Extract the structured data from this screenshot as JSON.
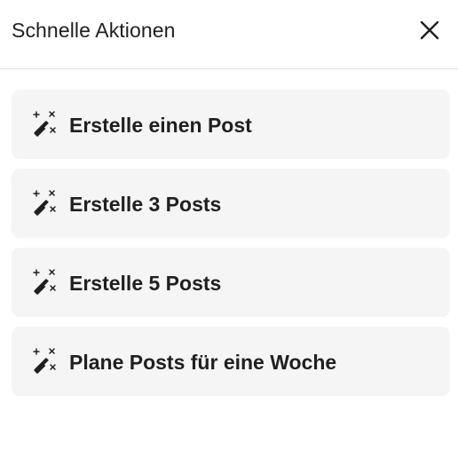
{
  "header": {
    "title": "Schnelle Aktionen",
    "close_icon": "close-icon"
  },
  "actions": [
    {
      "label": "Erstelle einen Post",
      "icon": "magic-wand-icon"
    },
    {
      "label": "Erstelle 3 Posts",
      "icon": "magic-wand-icon"
    },
    {
      "label": "Erstelle 5 Posts",
      "icon": "magic-wand-icon"
    },
    {
      "label": "Plane Posts für eine Woche",
      "icon": "magic-wand-icon"
    }
  ],
  "colors": {
    "background": "#ffffff",
    "card": "#f5f5f5",
    "text": "#1f1f1f",
    "divider": "#e2e2e2"
  }
}
